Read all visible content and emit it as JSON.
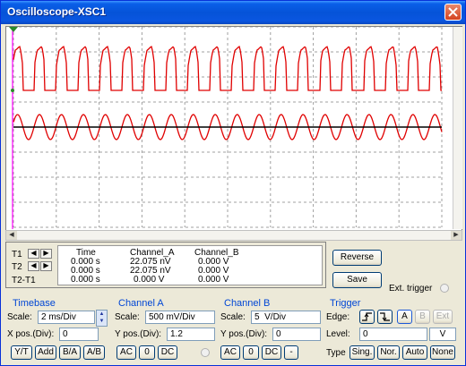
{
  "window": {
    "title": "Oscilloscope-XSC1"
  },
  "scope": {
    "background": "#ffffff",
    "grid_color": "#a0a0a0",
    "channel_a_color": "#e00000",
    "channel_b_color": "#000000",
    "cursor_color": "#ff00ff"
  },
  "measurements": {
    "rows": [
      {
        "label": "T1",
        "time": "0.000 s",
        "channel_a": "22.075 nV",
        "channel_b": "0.000 V"
      },
      {
        "label": "T2",
        "time": "0.000 s",
        "channel_a": "22.075 nV",
        "channel_b": "0.000 V"
      },
      {
        "label": "T2-T1",
        "time": "0.000 s",
        "channel_a": "0.000 V",
        "channel_b": "0.000 V"
      }
    ],
    "headers": {
      "time": "Time",
      "channel_a": "Channel_A",
      "channel_b": "Channel_B"
    },
    "reverse_label": "Reverse",
    "save_label": "Save",
    "ext_trigger_label": "Ext. trigger"
  },
  "timebase": {
    "title": "Timebase",
    "scale_label": "Scale:",
    "scale_value": "2 ms/Div",
    "xpos_label": "X pos.(Div):",
    "xpos_value": "0",
    "buttons": [
      "Y/T",
      "Add",
      "B/A",
      "A/B"
    ]
  },
  "channel_a": {
    "title": "Channel A",
    "scale_label": "Scale:",
    "scale_value": "500 mV/Div",
    "ypos_label": "Y pos.(Div):",
    "ypos_value": "1.2",
    "buttons": [
      "AC",
      "0",
      "DC"
    ]
  },
  "channel_b": {
    "title": "Channel B",
    "scale_label": "Scale:",
    "scale_value": "5  V/Div",
    "ypos_label": "Y pos.(Div):",
    "ypos_value": "0",
    "buttons": [
      "AC",
      "0",
      "DC",
      "-"
    ]
  },
  "trigger": {
    "title": "Trigger",
    "edge_label": "Edge:",
    "edge_buttons": [
      "A",
      "B",
      "Ext"
    ],
    "level_label": "Level:",
    "level_value": "0",
    "level_unit": "V",
    "type_label": "Type",
    "type_buttons": [
      "Sing.",
      "Nor.",
      "Auto",
      "None"
    ]
  }
}
